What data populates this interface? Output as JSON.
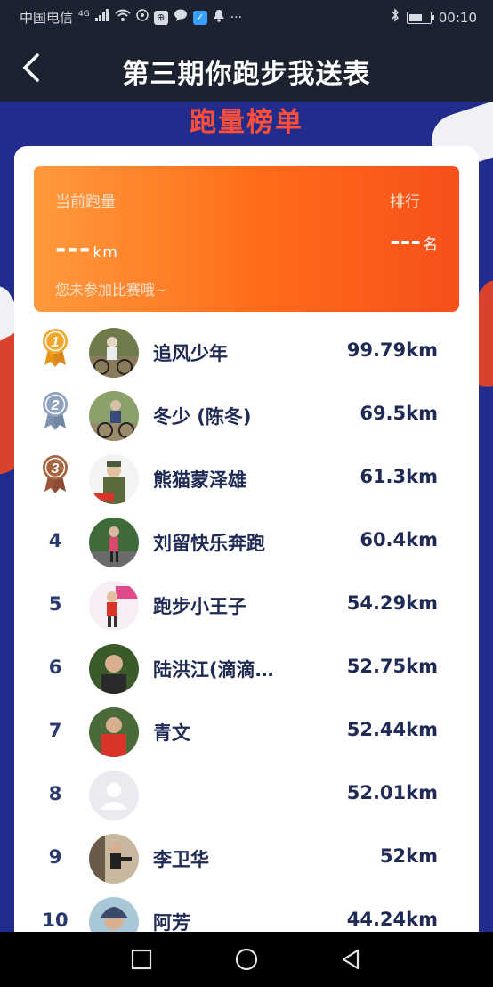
{
  "status": {
    "carrier": "中国电信",
    "signal_type": "4G",
    "time": "00:10"
  },
  "header": {
    "title": "第三期你跑步我送表"
  },
  "banner": {
    "title": "跑量榜单"
  },
  "my_score": {
    "distance_label": "当前跑量",
    "rank_label": "排行",
    "distance_value": "---",
    "distance_unit": "km",
    "rank_value": "---",
    "rank_unit": "名",
    "note": "您未参加比赛哦~"
  },
  "colors": {
    "gold": "#f0a72b",
    "silver": "#8fa3bf",
    "bronze": "#a8643f",
    "accent": "#ff6a1a"
  },
  "leaderboard": [
    {
      "rank": "1",
      "name": "追风少年",
      "distance": "99.79km",
      "medal": "gold"
    },
    {
      "rank": "2",
      "name": "冬少 (陈冬)",
      "distance": "69.5km",
      "medal": "silver"
    },
    {
      "rank": "3",
      "name": "熊猫蒙泽雄",
      "distance": "61.3km",
      "medal": "bronze"
    },
    {
      "rank": "4",
      "name": "刘留快乐奔跑",
      "distance": "60.4km"
    },
    {
      "rank": "5",
      "name": "跑步小王子",
      "distance": "54.29km"
    },
    {
      "rank": "6",
      "name": "陆洪江(滴滴…",
      "distance": "52.75km"
    },
    {
      "rank": "7",
      "name": "青文",
      "distance": "52.44km"
    },
    {
      "rank": "8",
      "name": "",
      "distance": "52.01km"
    },
    {
      "rank": "9",
      "name": "李卫华",
      "distance": "52km"
    },
    {
      "rank": "10",
      "name": "阿芳",
      "distance": "44.24km"
    }
  ]
}
